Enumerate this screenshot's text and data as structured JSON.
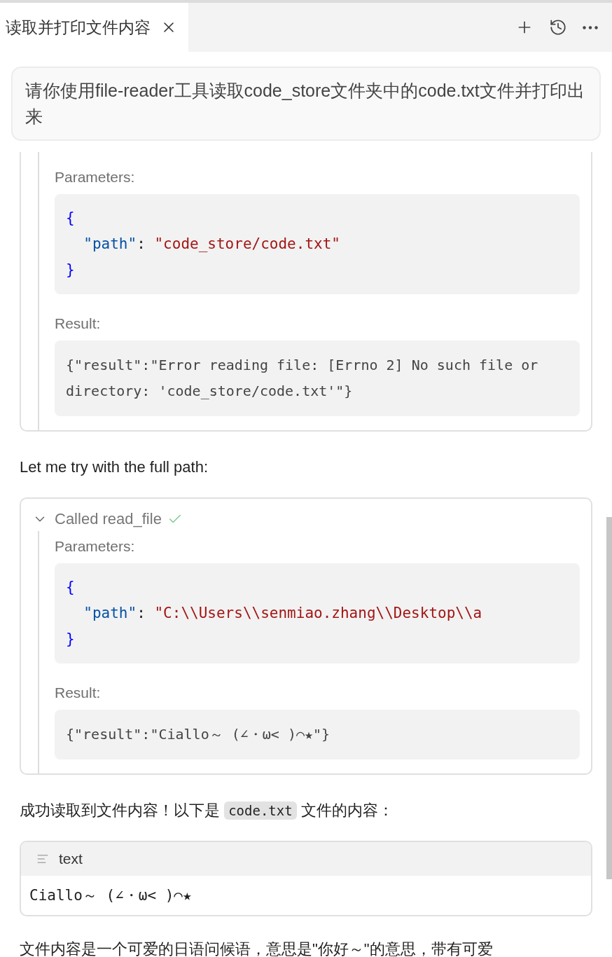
{
  "tab": {
    "title": "读取并打印文件内容",
    "selected": true
  },
  "toolbar": [
    {
      "kind": "add"
    },
    {
      "kind": "history"
    },
    {
      "kind": "more"
    }
  ],
  "user_message": "请你使用file-reader工具读取code_store文件夹中的code.txt文件并打印出来",
  "messages": [
    {
      "kind": "tool_call",
      "params_label": "Parameters:",
      "params": [
        [
          {
            "kind": "brace",
            "text": "{"
          }
        ],
        [
          {
            "kind": "key",
            "text": "  \"path\""
          },
          {
            "kind": "punct",
            "text": ": "
          },
          {
            "kind": "string",
            "text": "\"code_store/code.txt\""
          }
        ],
        [
          {
            "kind": "brace",
            "text": "}"
          }
        ]
      ],
      "result_label": "Result:",
      "result": "{\"result\":\"Error reading file: [Errno 2] No such file or directory: 'code_store/code.txt'\"}"
    },
    {
      "kind": "text",
      "parts": [
        {
          "kind": "plain",
          "text": "Let me try with the full path:"
        }
      ]
    },
    {
      "kind": "tool_call",
      "header": {
        "label": "Called read_file",
        "expanded": true,
        "success": true
      },
      "params_label": "Parameters:",
      "params": [
        [
          {
            "kind": "brace",
            "text": "{"
          }
        ],
        [
          {
            "kind": "key",
            "text": "  \"path\""
          },
          {
            "kind": "punct",
            "text": ": "
          },
          {
            "kind": "string",
            "text": "\"C:\\\\Users\\\\senmiao.zhang\\\\Desktop\\\\a"
          }
        ],
        [
          {
            "kind": "brace",
            "text": "}"
          }
        ]
      ],
      "result_label": "Result:",
      "result": "{\"result\":\"Ciallo～ (∠・ω< )⌒★\"}"
    },
    {
      "kind": "text",
      "parts": [
        {
          "kind": "plain",
          "text": "成功读取到文件内容！以下是 "
        },
        {
          "kind": "code",
          "text": "code.txt"
        },
        {
          "kind": "plain",
          "text": " 文件的内容："
        }
      ]
    },
    {
      "kind": "code_block",
      "language": "text",
      "code": "Ciallo～ (∠・ω< )⌒★"
    },
    {
      "kind": "text",
      "parts": [
        {
          "kind": "plain",
          "text": "文件内容是一个可爱的日语问候语，意思是\"你好～\"的意思，带有可爱"
        }
      ]
    }
  ]
}
